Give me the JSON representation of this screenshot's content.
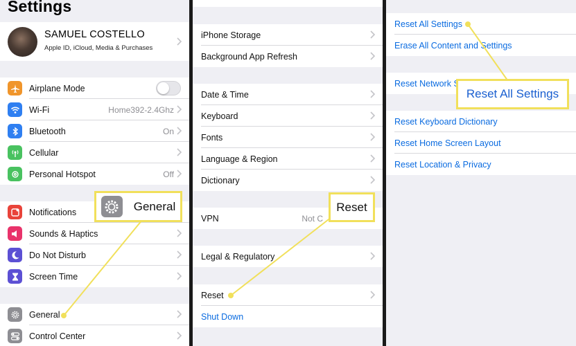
{
  "panel1": {
    "title": "Settings",
    "profile": {
      "name": "SAMUEL COSTELLO",
      "subtitle": "Apple ID, iCloud, Media & Purchases"
    },
    "group1": [
      {
        "label": "Airplane Mode",
        "value": "",
        "icon": "airplane-icon",
        "color": "#f0952b"
      },
      {
        "label": "Wi-Fi",
        "value": "Home392-2.4Ghz",
        "icon": "wifi-icon",
        "color": "#2f7ff1"
      },
      {
        "label": "Bluetooth",
        "value": "On",
        "icon": "bluetooth-icon",
        "color": "#2f7ff1"
      },
      {
        "label": "Cellular",
        "value": "",
        "icon": "cellular-icon",
        "color": "#49c260"
      },
      {
        "label": "Personal Hotspot",
        "value": "Off",
        "icon": "hotspot-icon",
        "color": "#49c260"
      }
    ],
    "group2": [
      {
        "label": "Notifications",
        "icon": "notifications-icon",
        "color": "#e9433a"
      },
      {
        "label": "Sounds & Haptics",
        "icon": "sounds-icon",
        "color": "#e9336b"
      },
      {
        "label": "Do Not Disturb",
        "icon": "moon-icon",
        "color": "#5c50d4"
      },
      {
        "label": "Screen Time",
        "icon": "hourglass-icon",
        "color": "#5c50d4"
      }
    ],
    "group3": [
      {
        "label": "General",
        "icon": "gear-icon",
        "color": "#8e8e93"
      },
      {
        "label": "Control Center",
        "icon": "toggles-icon",
        "color": "#8e8e93"
      }
    ]
  },
  "panel2": {
    "group1": [
      "iPhone Storage",
      "Background App Refresh"
    ],
    "group2": [
      "Date & Time",
      "Keyboard",
      "Fonts",
      "Language & Region",
      "Dictionary"
    ],
    "vpn": {
      "label": "VPN",
      "value": "Not C"
    },
    "legal": "Legal & Regulatory",
    "reset": "Reset",
    "shutdown": "Shut Down"
  },
  "panel3": {
    "group1": [
      "Reset All Settings",
      "Erase All Content and Settings"
    ],
    "network": "Reset Network Se",
    "group3": [
      "Reset Keyboard Dictionary",
      "Reset Home Screen Layout",
      "Reset Location & Privacy"
    ]
  },
  "callouts": {
    "general": "General",
    "reset": "Reset",
    "reset_all": "Reset All Settings"
  },
  "colors": {
    "highlight": "#f1e05b",
    "link_blue": "#0a6be0"
  }
}
